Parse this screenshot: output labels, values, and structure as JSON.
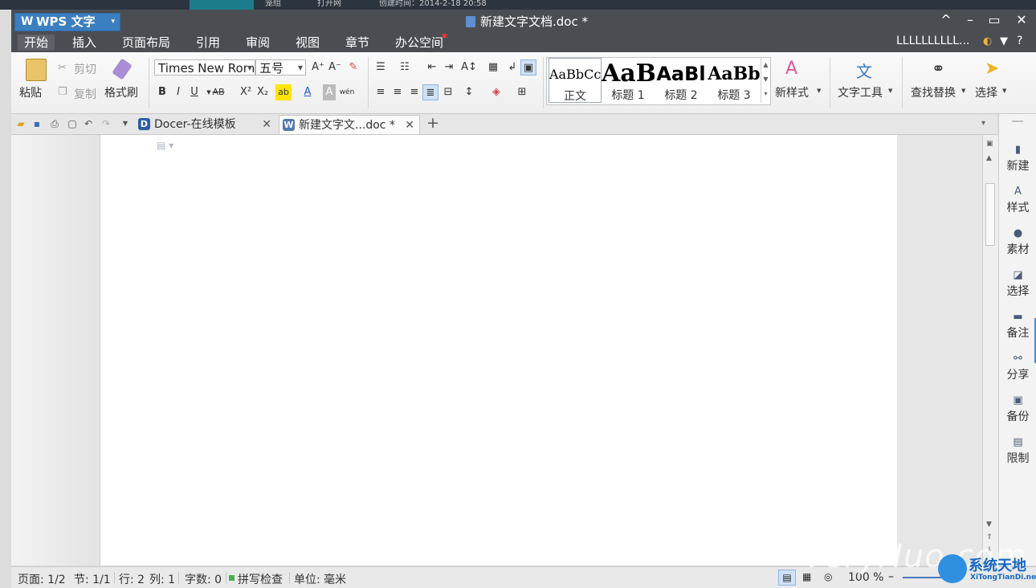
{
  "desktop": {
    "text_left": "笼组",
    "text_mid": "打开网",
    "text_right": "创建时间：2014-2-18 20:58"
  },
  "titlebar": {
    "app_icon": "W",
    "app_name": "WPS 文字",
    "app_dd": "▾",
    "doc_title": "新建文字文档.doc *",
    "min": "–",
    "restore": "^",
    "max": "▭",
    "close": "✕"
  },
  "menu": {
    "items": [
      "开始",
      "插入",
      "页面布局",
      "引用",
      "审阅",
      "视图",
      "章节",
      "办公空间"
    ],
    "user": "LLLLLLLLLL..."
  },
  "ribbon": {
    "paste": "粘贴",
    "cut": "剪切",
    "copy": "复制",
    "format_painter": "格式刷",
    "font_name": "Times New Roman",
    "font_size": "五号",
    "styles": [
      {
        "preview": "AaBbCc",
        "name": "正文"
      },
      {
        "preview": "AaB",
        "name": "标题 1"
      },
      {
        "preview": "AaBl",
        "name": "标题 2"
      },
      {
        "preview": "AaBb",
        "name": "标题 3"
      }
    ],
    "new_style": "新样式",
    "text_tools": "文字工具",
    "find_replace": "查找替换",
    "select": "选择",
    "bold": "B",
    "italic": "I",
    "underline": "U",
    "strike": "AB",
    "superscript": "X²",
    "subscript": "X₂",
    "font_color": "A",
    "char_shading": "A",
    "pinyin": "wén"
  },
  "tabs": {
    "docer": "Docer-在线模板",
    "doc": "新建文字文...doc *",
    "close": "✕",
    "add": "+"
  },
  "taskpane": {
    "items": [
      "新建",
      "样式",
      "素材",
      "选择",
      "备注",
      "分享",
      "备份",
      "限制"
    ]
  },
  "statusbar": {
    "page": "页面: 1/2",
    "section": "节: 1/1",
    "row": "行: 2",
    "col": "列: 1",
    "words": "字数: 0",
    "spell": "拼写检查",
    "unit": "单位: 毫米",
    "zoom": "100 %"
  },
  "watermark": {
    "text": "VeryHuo.com",
    "cn": "系统天地",
    "en": "XiTongTianDi.net"
  }
}
